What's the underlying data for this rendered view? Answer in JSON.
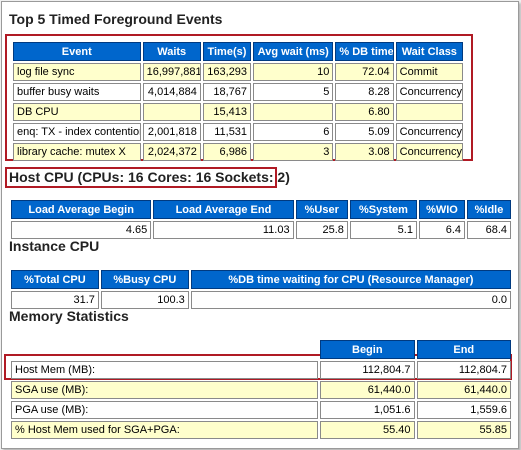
{
  "top5": {
    "title": "Top 5 Timed Foreground Events",
    "headers": [
      "Event",
      "Waits",
      "Time(s)",
      "Avg wait (ms)",
      "% DB time",
      "Wait Class"
    ],
    "rows": [
      [
        "log file sync",
        "16,997,881",
        "163,293",
        "10",
        "72.04",
        "Commit"
      ],
      [
        "buffer busy waits",
        "4,014,884",
        "18,767",
        "5",
        "8.28",
        "Concurrency"
      ],
      [
        "DB CPU",
        "",
        "15,413",
        "",
        "6.80",
        ""
      ],
      [
        "enq: TX - index contention",
        "2,001,818",
        "11,531",
        "6",
        "5.09",
        "Concurrency"
      ],
      [
        "library cache: mutex X",
        "2,024,372",
        "6,986",
        "3",
        "3.08",
        "Concurrency"
      ]
    ]
  },
  "host_cpu": {
    "title": "Host CPU (CPUs: 16 Cores: 16 Sockets: 2)",
    "headers": [
      "Load Average Begin",
      "Load Average End",
      "%User",
      "%System",
      "%WIO",
      "%Idle"
    ],
    "row": [
      "4.65",
      "11.03",
      "25.8",
      "5.1",
      "6.4",
      "68.4"
    ]
  },
  "instance_cpu": {
    "title": "Instance CPU",
    "headers": [
      "%Total CPU",
      "%Busy CPU",
      "%DB time waiting for CPU (Resource Manager)"
    ],
    "row": [
      "31.7",
      "100.3",
      "0.0"
    ]
  },
  "memory": {
    "title": "Memory Statistics",
    "headers": [
      "",
      "Begin",
      "End"
    ],
    "rows": [
      [
        "Host Mem (MB):",
        "112,804.7",
        "112,804.7"
      ],
      [
        "SGA use (MB):",
        "61,440.0",
        "61,440.0"
      ],
      [
        "PGA use (MB):",
        "1,051.6",
        "1,559.6"
      ],
      [
        "% Host Mem used for SGA+PGA:",
        "55.40",
        "55.85"
      ]
    ]
  },
  "colors": {
    "header_bg": "#0066cc",
    "row_alt": "#ffffcc",
    "highlight": "#b01a24"
  }
}
